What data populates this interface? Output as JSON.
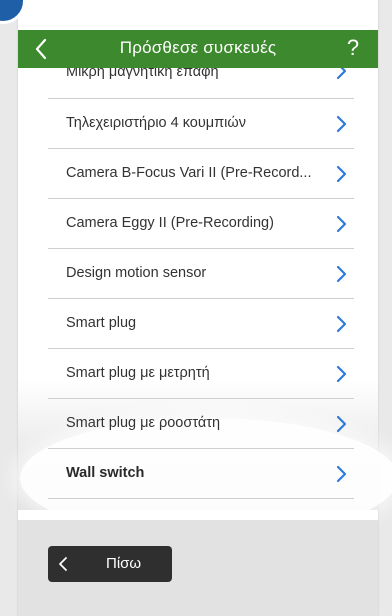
{
  "header": {
    "title": "Πρόσθεσε συσκευές",
    "help_label": "?"
  },
  "devices": [
    {
      "label": "Μικρή μαγνητική επαφή"
    },
    {
      "label": "Τηλεχειριστήριο 4 κουμπιών"
    },
    {
      "label": "Camera B-Focus Vari II (Pre-Record..."
    },
    {
      "label": "Camera Eggy II (Pre-Recording)"
    },
    {
      "label": "Design motion sensor"
    },
    {
      "label": "Smart plug"
    },
    {
      "label": "Smart plug με μετρητή"
    },
    {
      "label": "Smart plug με ροοστάτη"
    },
    {
      "label": "Wall switch"
    }
  ],
  "footer": {
    "back_label": "Πίσω"
  },
  "colors": {
    "header_bg": "#3d8a2e",
    "chevron": "#2f7bd9",
    "back_button_bg": "#2f2f2f"
  }
}
